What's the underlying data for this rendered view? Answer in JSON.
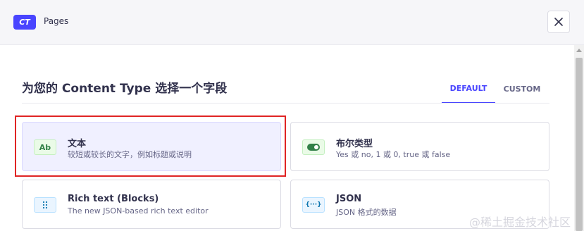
{
  "header": {
    "badge": "CT",
    "title": "Pages",
    "close_icon": "close-icon"
  },
  "section": {
    "title": "为您的 Content Type 选择一个字段"
  },
  "tabs": [
    {
      "label": "DEFAULT",
      "active": true
    },
    {
      "label": "CUSTOM",
      "active": false
    }
  ],
  "fields": [
    {
      "icon": "text-field-icon",
      "icon_label": "Ab",
      "title": "文本",
      "description": "较短或较长的文字，例如标题或说明",
      "selected": true
    },
    {
      "icon": "boolean-toggle-icon",
      "title": "布尔类型",
      "description": "Yes 或 no, 1 或 0, true 或 false",
      "selected": false
    },
    {
      "icon": "rich-text-blocks-icon",
      "title": "Rich text (Blocks)",
      "description": "The new JSON-based rich text editor",
      "selected": false
    },
    {
      "icon": "json-braces-icon",
      "icon_label": "{···}",
      "title": "JSON",
      "description": "JSON 格式的数据",
      "selected": false
    }
  ],
  "watermark": "@稀土掘金技术社区",
  "colors": {
    "primary": "#4945ff",
    "highlight": "#e02424",
    "selected_card_bg": "#f0f0ff",
    "success": "#328048"
  }
}
